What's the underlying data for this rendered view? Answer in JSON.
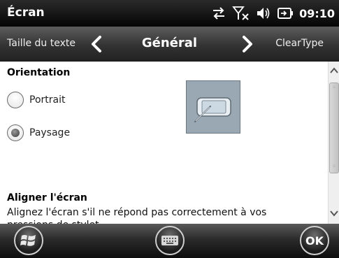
{
  "statusbar": {
    "title": "Écran",
    "clock": "09:10",
    "icons": [
      "connectivity-icon",
      "signal-off-icon",
      "volume-icon",
      "battery-icon"
    ]
  },
  "tabs": {
    "previous": "Taille du texte",
    "current": "Général",
    "next": "ClearType"
  },
  "orientation": {
    "heading": "Orientation",
    "options": [
      {
        "label": "Portrait",
        "checked": false
      },
      {
        "label": "Paysage",
        "checked": true
      }
    ]
  },
  "align": {
    "heading": "Aligner l'écran",
    "description": "Alignez l'écran s'il ne répond pas correctement à vos pressions de stylet."
  },
  "bottombar": {
    "ok_label": "OK"
  },
  "colors": {
    "statusbar_bg": "#050505",
    "content_bg": "#ffffff",
    "preview_bg": "#9aa8b3"
  }
}
